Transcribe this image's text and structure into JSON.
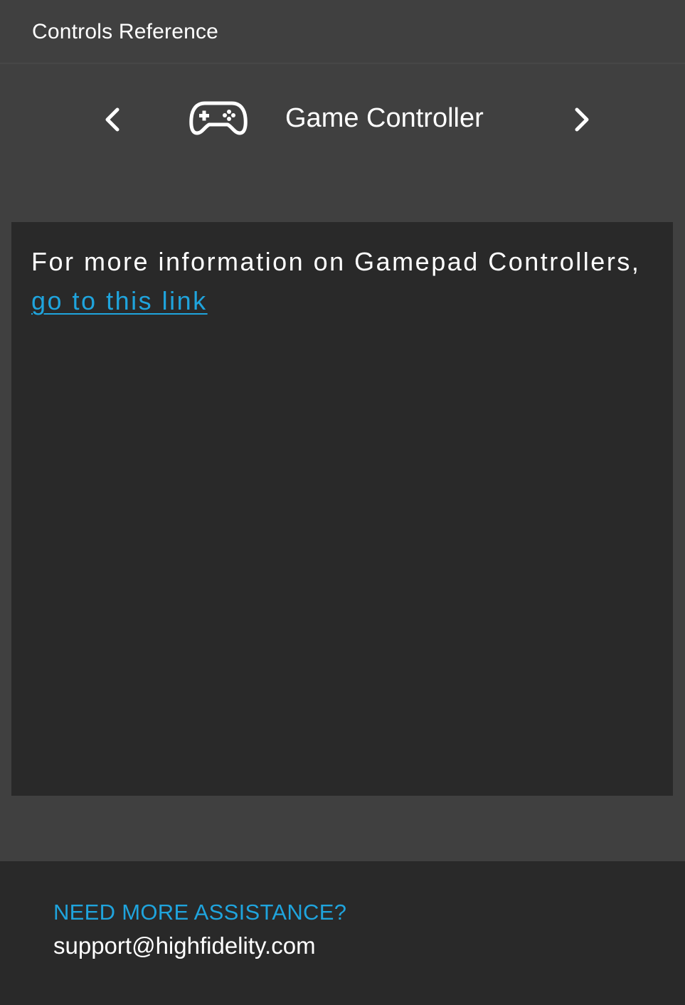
{
  "header": {
    "title": "Controls Reference"
  },
  "nav": {
    "prev_icon": "chevron-left-icon",
    "next_icon": "chevron-right-icon",
    "device_icon": "gamepad-icon",
    "device_title": "Game Controller"
  },
  "content": {
    "info_text": "For more information on Gamepad Controllers, ",
    "link_text": "go to this link",
    "link_color": "#1fa4dd"
  },
  "footer": {
    "heading": "NEED MORE ASSISTANCE?",
    "email": "support@highfidelity.com",
    "heading_color": "#1fa4dd"
  },
  "colors": {
    "background": "#404040",
    "panel": "#292929",
    "accent": "#1fa4dd",
    "text": "#ffffff"
  }
}
